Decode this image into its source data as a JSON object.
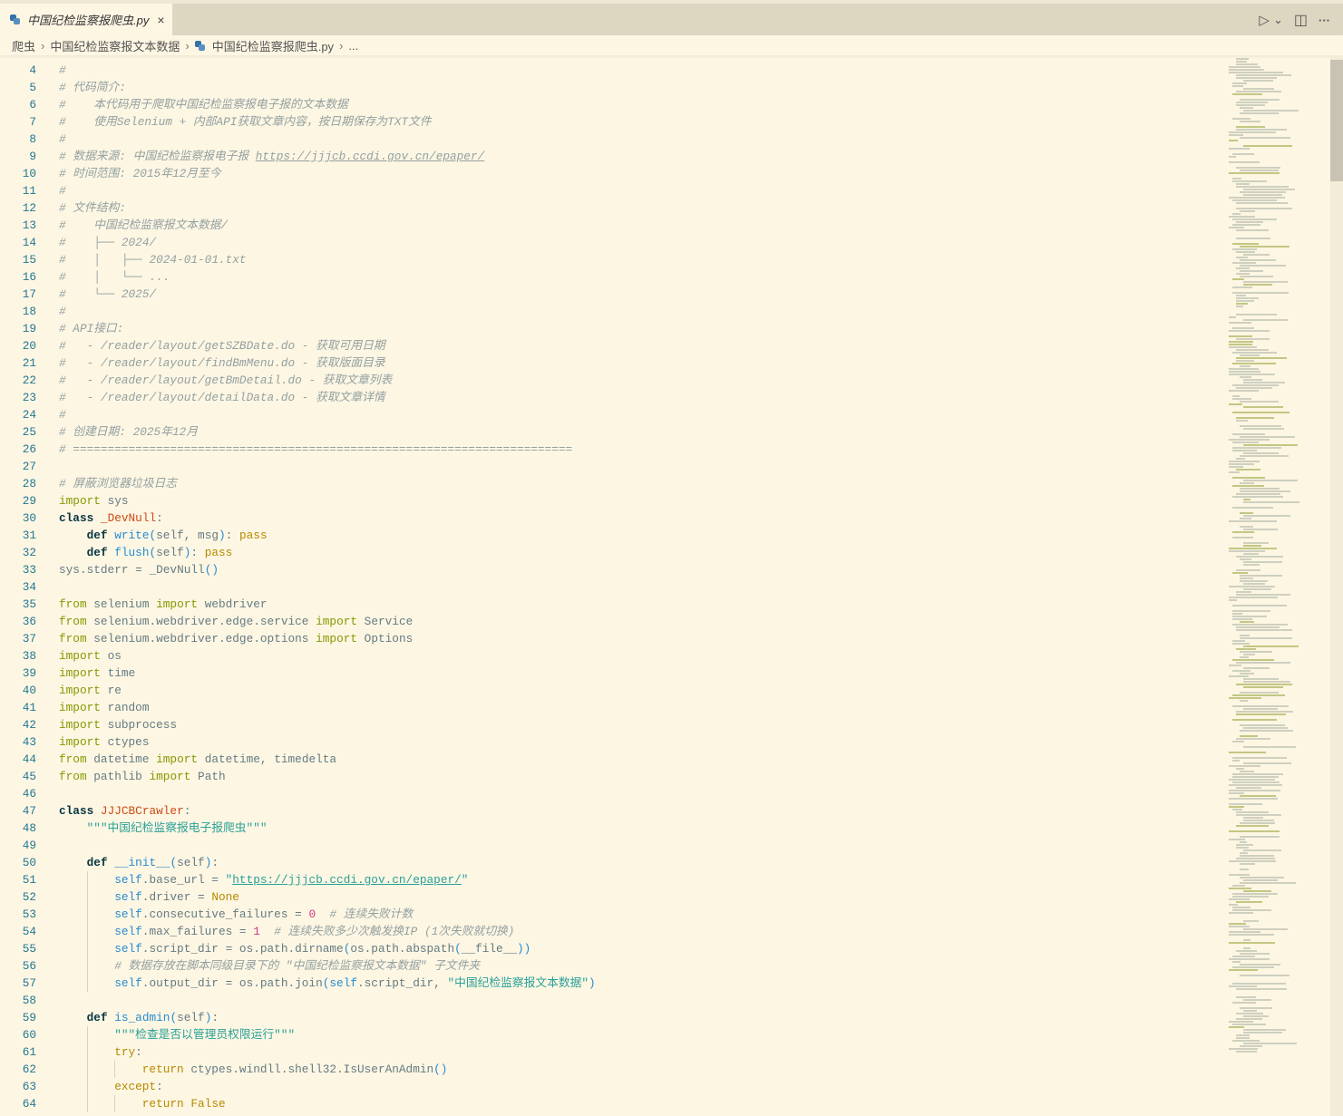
{
  "tab": {
    "title": "中国纪检监察报爬虫.py",
    "close": "×"
  },
  "actions": {
    "run": "▷",
    "run_menu": "⌄",
    "split": "◫",
    "more": "···"
  },
  "breadcrumb": [
    "爬虫",
    "中国纪检监察报文本数据",
    "中国纪检监察报爬虫.py",
    "..."
  ],
  "colors": {
    "background": "#fdf6e3",
    "comment": "#93a1a1",
    "keyword": "#859900",
    "string": "#2aa198",
    "number": "#d33682",
    "self": "#268bd2",
    "classname": "#cb4b16"
  },
  "code": [
    {
      "n": "4",
      "i": 0,
      "t": [
        [
          "c",
          "#"
        ]
      ]
    },
    {
      "n": "5",
      "i": 0,
      "t": [
        [
          "c",
          "# 代码简介:"
        ]
      ]
    },
    {
      "n": "6",
      "i": 0,
      "t": [
        [
          "c",
          "#    本代码用于爬取中国纪检监察报电子报的文本数据"
        ]
      ]
    },
    {
      "n": "7",
      "i": 0,
      "t": [
        [
          "c",
          "#    使用Selenium + 内部API获取文章内容，按日期保存为TXT文件"
        ]
      ]
    },
    {
      "n": "8",
      "i": 0,
      "t": [
        [
          "c",
          "#"
        ]
      ]
    },
    {
      "n": "9",
      "i": 0,
      "t": [
        [
          "c",
          "# 数据来源: 中国纪检监察报电子报 "
        ],
        [
          "c u",
          "https://jjjcb.ccdi.gov.cn/epaper/"
        ]
      ]
    },
    {
      "n": "10",
      "i": 0,
      "t": [
        [
          "c",
          "# 时间范围: 2015年12月至今"
        ]
      ]
    },
    {
      "n": "11",
      "i": 0,
      "t": [
        [
          "c",
          "#"
        ]
      ]
    },
    {
      "n": "12",
      "i": 0,
      "t": [
        [
          "c",
          "# 文件结构:"
        ]
      ]
    },
    {
      "n": "13",
      "i": 0,
      "t": [
        [
          "c",
          "#    中国纪检监察报文本数据/"
        ]
      ]
    },
    {
      "n": "14",
      "i": 0,
      "t": [
        [
          "c",
          "#    ├── 2024/"
        ]
      ]
    },
    {
      "n": "15",
      "i": 0,
      "t": [
        [
          "c",
          "#    │   ├── 2024-01-01.txt"
        ]
      ]
    },
    {
      "n": "16",
      "i": 0,
      "t": [
        [
          "c",
          "#    │   └── ..."
        ]
      ]
    },
    {
      "n": "17",
      "i": 0,
      "t": [
        [
          "c",
          "#    └── 2025/"
        ]
      ]
    },
    {
      "n": "18",
      "i": 0,
      "t": [
        [
          "c",
          "#"
        ]
      ]
    },
    {
      "n": "19",
      "i": 0,
      "t": [
        [
          "c",
          "# API接口:"
        ]
      ]
    },
    {
      "n": "20",
      "i": 0,
      "t": [
        [
          "c",
          "#   - /reader/layout/getSZBDate.do - 获取可用日期"
        ]
      ]
    },
    {
      "n": "21",
      "i": 0,
      "t": [
        [
          "c",
          "#   - /reader/layout/findBmMenu.do - 获取版面目录"
        ]
      ]
    },
    {
      "n": "22",
      "i": 0,
      "t": [
        [
          "c",
          "#   - /reader/layout/getBmDetail.do - 获取文章列表"
        ]
      ]
    },
    {
      "n": "23",
      "i": 0,
      "t": [
        [
          "c",
          "#   - /reader/layout/detailData.do - 获取文章详情"
        ]
      ]
    },
    {
      "n": "24",
      "i": 0,
      "t": [
        [
          "c",
          "#"
        ]
      ]
    },
    {
      "n": "25",
      "i": 0,
      "t": [
        [
          "c",
          "# 创建日期: 2025年12月"
        ]
      ]
    },
    {
      "n": "26",
      "i": 0,
      "t": [
        [
          "c",
          "# ========================================================================"
        ]
      ]
    },
    {
      "n": "27",
      "i": 0,
      "t": []
    },
    {
      "n": "28",
      "i": 0,
      "t": [
        [
          "c",
          "# 屏蔽浏览器垃圾日志"
        ]
      ]
    },
    {
      "n": "29",
      "i": 0,
      "t": [
        [
          "k",
          "import"
        ],
        [
          "p",
          " sys"
        ]
      ]
    },
    {
      "n": "30",
      "i": 0,
      "t": [
        [
          "d",
          "class"
        ],
        [
          "p",
          " "
        ],
        [
          "o",
          "_DevNull"
        ],
        [
          "p",
          ":"
        ]
      ]
    },
    {
      "n": "31",
      "i": 1,
      "t": [
        [
          "d",
          "def"
        ],
        [
          "p",
          " "
        ],
        [
          "s",
          "write"
        ],
        [
          "b",
          "("
        ],
        [
          "p",
          "self, msg"
        ],
        [
          "b",
          ")"
        ],
        [
          "p",
          ": "
        ],
        [
          "y",
          "pass"
        ]
      ]
    },
    {
      "n": "32",
      "i": 1,
      "t": [
        [
          "d",
          "def"
        ],
        [
          "p",
          " "
        ],
        [
          "s",
          "flush"
        ],
        [
          "b",
          "("
        ],
        [
          "p",
          "self"
        ],
        [
          "b",
          ")"
        ],
        [
          "p",
          ": "
        ],
        [
          "y",
          "pass"
        ]
      ]
    },
    {
      "n": "33",
      "i": 0,
      "t": [
        [
          "p",
          "sys.stderr = _DevNull"
        ],
        [
          "b",
          "()"
        ]
      ]
    },
    {
      "n": "34",
      "i": 0,
      "t": []
    },
    {
      "n": "35",
      "i": 0,
      "t": [
        [
          "k",
          "from"
        ],
        [
          "p",
          " selenium "
        ],
        [
          "k",
          "import"
        ],
        [
          "p",
          " webdriver"
        ]
      ]
    },
    {
      "n": "36",
      "i": 0,
      "t": [
        [
          "k",
          "from"
        ],
        [
          "p",
          " selenium.webdriver.edge.service "
        ],
        [
          "k",
          "import"
        ],
        [
          "p",
          " Service"
        ]
      ]
    },
    {
      "n": "37",
      "i": 0,
      "t": [
        [
          "k",
          "from"
        ],
        [
          "p",
          " selenium.webdriver.edge.options "
        ],
        [
          "k",
          "import"
        ],
        [
          "p",
          " Options"
        ]
      ]
    },
    {
      "n": "38",
      "i": 0,
      "t": [
        [
          "k",
          "import"
        ],
        [
          "p",
          " os"
        ]
      ]
    },
    {
      "n": "39",
      "i": 0,
      "t": [
        [
          "k",
          "import"
        ],
        [
          "p",
          " time"
        ]
      ]
    },
    {
      "n": "40",
      "i": 0,
      "t": [
        [
          "k",
          "import"
        ],
        [
          "p",
          " re"
        ]
      ]
    },
    {
      "n": "41",
      "i": 0,
      "t": [
        [
          "k",
          "import"
        ],
        [
          "p",
          " random"
        ]
      ]
    },
    {
      "n": "42",
      "i": 0,
      "t": [
        [
          "k",
          "import"
        ],
        [
          "p",
          " subprocess"
        ]
      ]
    },
    {
      "n": "43",
      "i": 0,
      "t": [
        [
          "k",
          "import"
        ],
        [
          "p",
          " ctypes"
        ]
      ]
    },
    {
      "n": "44",
      "i": 0,
      "t": [
        [
          "k",
          "from"
        ],
        [
          "p",
          " datetime "
        ],
        [
          "k",
          "import"
        ],
        [
          "p",
          " datetime, timedelta"
        ]
      ]
    },
    {
      "n": "45",
      "i": 0,
      "t": [
        [
          "k",
          "from"
        ],
        [
          "p",
          " pathlib "
        ],
        [
          "k",
          "import"
        ],
        [
          "p",
          " Path"
        ]
      ]
    },
    {
      "n": "46",
      "i": 0,
      "t": []
    },
    {
      "n": "47",
      "i": 0,
      "t": [
        [
          "d",
          "class"
        ],
        [
          "p",
          " "
        ],
        [
          "o",
          "JJJCBCrawler"
        ],
        [
          "p",
          ":"
        ]
      ]
    },
    {
      "n": "48",
      "i": 1,
      "t": [
        [
          "t",
          "\"\"\"中国纪检监察报电子报爬虫\"\"\""
        ]
      ]
    },
    {
      "n": "49",
      "i": 1,
      "t": []
    },
    {
      "n": "50",
      "i": 1,
      "t": [
        [
          "d",
          "def"
        ],
        [
          "p",
          " "
        ],
        [
          "s",
          "__init__"
        ],
        [
          "b",
          "("
        ],
        [
          "p",
          "self"
        ],
        [
          "b",
          ")"
        ],
        [
          "p",
          ":"
        ]
      ]
    },
    {
      "n": "51",
      "i": 2,
      "t": [
        [
          "s",
          "self"
        ],
        [
          "p",
          ".base_url = "
        ],
        [
          "t",
          "\""
        ],
        [
          "t u",
          "https://jjjcb.ccdi.gov.cn/epaper/"
        ],
        [
          "t",
          "\""
        ]
      ]
    },
    {
      "n": "52",
      "i": 2,
      "t": [
        [
          "s",
          "self"
        ],
        [
          "p",
          ".driver = "
        ],
        [
          "y",
          "None"
        ]
      ]
    },
    {
      "n": "53",
      "i": 2,
      "t": [
        [
          "s",
          "self"
        ],
        [
          "p",
          ".consecutive_failures = "
        ],
        [
          "n",
          "0"
        ],
        [
          "p",
          "  "
        ],
        [
          "c",
          "# 连续失败计数"
        ]
      ]
    },
    {
      "n": "54",
      "i": 2,
      "t": [
        [
          "s",
          "self"
        ],
        [
          "p",
          ".max_failures = "
        ],
        [
          "n",
          "1"
        ],
        [
          "p",
          "  "
        ],
        [
          "c",
          "# 连续失败多少次触发换IP (1次失败就切换)"
        ]
      ]
    },
    {
      "n": "55",
      "i": 2,
      "t": [
        [
          "s",
          "self"
        ],
        [
          "p",
          ".script_dir = os.path.dirname"
        ],
        [
          "b",
          "("
        ],
        [
          "p",
          "os.path.abspath"
        ],
        [
          "b",
          "("
        ],
        [
          "p",
          "__file__"
        ],
        [
          "b",
          "))"
        ]
      ]
    },
    {
      "n": "56",
      "i": 2,
      "t": [
        [
          "c",
          "# 数据存放在脚本同级目录下的 \"中国纪检监察报文本数据\" 子文件夹"
        ]
      ]
    },
    {
      "n": "57",
      "i": 2,
      "t": [
        [
          "s",
          "self"
        ],
        [
          "p",
          ".output_dir = os.path.join"
        ],
        [
          "b",
          "("
        ],
        [
          "s",
          "self"
        ],
        [
          "p",
          ".script_dir, "
        ],
        [
          "t",
          "\"中国纪检监察报文本数据\""
        ],
        [
          "b",
          ")"
        ]
      ]
    },
    {
      "n": "58",
      "i": 1,
      "t": []
    },
    {
      "n": "59",
      "i": 1,
      "t": [
        [
          "d",
          "def"
        ],
        [
          "p",
          " "
        ],
        [
          "s",
          "is_admin"
        ],
        [
          "b",
          "("
        ],
        [
          "p",
          "self"
        ],
        [
          "b",
          ")"
        ],
        [
          "p",
          ":"
        ]
      ]
    },
    {
      "n": "60",
      "i": 2,
      "t": [
        [
          "t",
          "\"\"\"检查是否以管理员权限运行\"\"\""
        ]
      ]
    },
    {
      "n": "61",
      "i": 2,
      "t": [
        [
          "y",
          "try"
        ],
        [
          "p",
          ":"
        ]
      ]
    },
    {
      "n": "62",
      "i": 3,
      "t": [
        [
          "y",
          "return"
        ],
        [
          "p",
          " ctypes.windll.shell32.IsUserAnAdmin"
        ],
        [
          "b",
          "()"
        ]
      ]
    },
    {
      "n": "63",
      "i": 2,
      "t": [
        [
          "y",
          "except"
        ],
        [
          "p",
          ":"
        ]
      ]
    },
    {
      "n": "64",
      "i": 3,
      "t": [
        [
          "y",
          "return"
        ],
        [
          "p",
          " "
        ],
        [
          "y",
          "False"
        ]
      ]
    }
  ]
}
